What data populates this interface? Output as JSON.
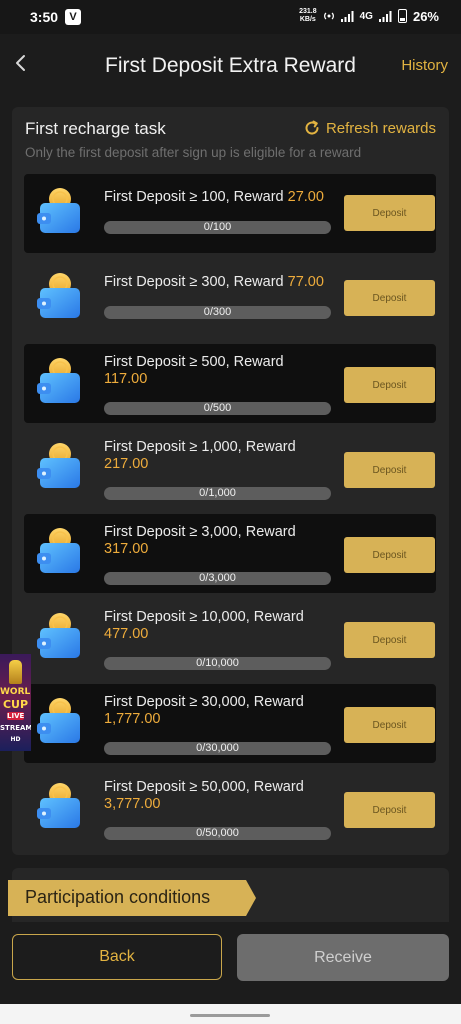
{
  "status_bar": {
    "time": "3:50",
    "app_badge": "V",
    "speed_value": "231.8",
    "speed_unit": "KB/s",
    "network": "4G",
    "battery": "26%"
  },
  "header": {
    "title": "First Deposit Extra Reward",
    "history": "History",
    "back_icon": "chevron-left-icon"
  },
  "task_section": {
    "title": "First recharge task",
    "refresh": "Refresh rewards",
    "subtitle": "Only the first deposit after sign up is eligible for a reward"
  },
  "tasks": [
    {
      "prefix": "First Deposit ≥ 100, Reward ",
      "amount": "27.00",
      "progress": "0/100",
      "fill": 0,
      "button": "Deposit"
    },
    {
      "prefix": "First Deposit ≥ 300, Reward ",
      "amount": "77.00",
      "progress": "0/300",
      "fill": 0,
      "button": "Deposit"
    },
    {
      "prefix": "First Deposit ≥ 500, Reward",
      "amount": "117.00",
      "progress": "0/500",
      "fill": 0,
      "button": "Deposit"
    },
    {
      "prefix": "First Deposit ≥ 1,000, Reward",
      "amount": "217.00",
      "progress": "0/1,000",
      "fill": 0,
      "button": "Deposit"
    },
    {
      "prefix": "First Deposit ≥ 3,000, Reward",
      "amount": "317.00",
      "progress": "0/3,000",
      "fill": 0,
      "button": "Deposit"
    },
    {
      "prefix": "First Deposit ≥ 10,000, Reward",
      "amount": "477.00",
      "progress": "0/10,000",
      "fill": 0,
      "button": "Deposit"
    },
    {
      "prefix": "First Deposit ≥ 30,000, Reward",
      "amount": "1,777.00",
      "progress": "0/30,000",
      "fill": 0,
      "button": "Deposit"
    },
    {
      "prefix": "First Deposit ≥ 50,000, Reward",
      "amount": "3,777.00",
      "progress": "0/50,000",
      "fill": 0,
      "button": "Deposit"
    }
  ],
  "participation": {
    "title": "Participation conditions"
  },
  "footer": {
    "back": "Back",
    "receive": "Receive"
  },
  "floating_badge": {
    "line1": "WORLD",
    "line2": "CUP",
    "line3": "LIVE",
    "line4": "STREAM",
    "line5": "HD"
  },
  "colors": {
    "accent": "#e2b341",
    "reward": "#eeac3c",
    "button": "#d7b256",
    "background": "#1c1c1c",
    "panel": "#262626"
  }
}
